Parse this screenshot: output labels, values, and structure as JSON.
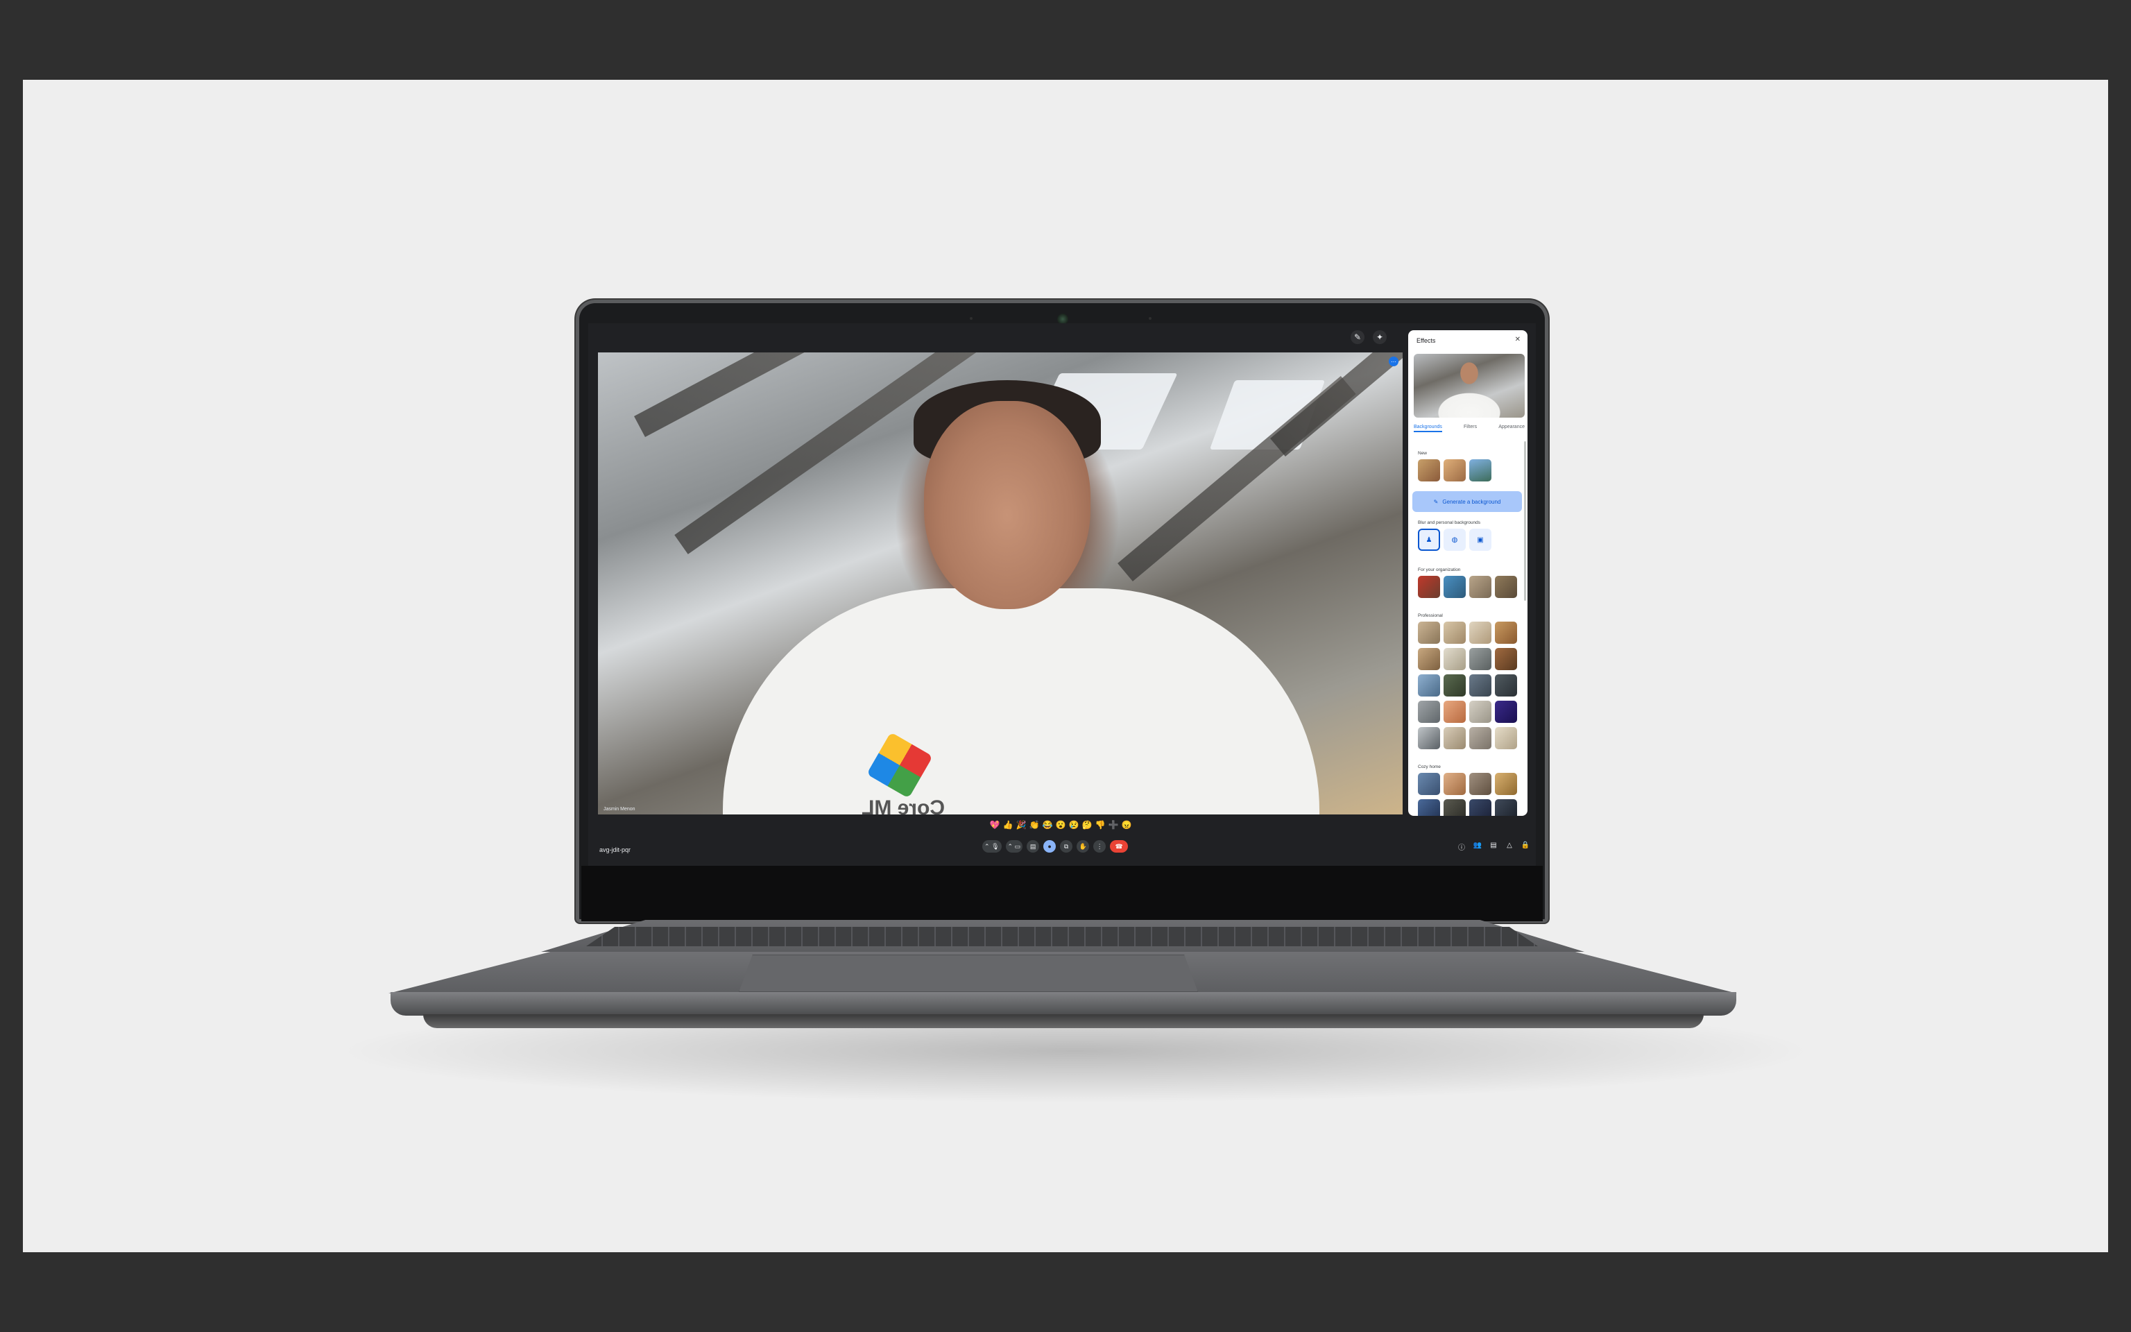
{
  "meeting": {
    "code": "avg-jdit-pqr",
    "participant_name": "Jasmin Menon"
  },
  "reactions": [
    "💖",
    "👍",
    "🎉",
    "👏",
    "😂",
    "😮",
    "😢",
    "🤔",
    "👎",
    "➕",
    "😠"
  ],
  "controls": {
    "more_label": "⌃",
    "mic_icon": "mic-icon",
    "camera_icon": "camera-icon",
    "captions_icon": "captions-icon",
    "effects_icon": "effects-icon",
    "present_icon": "present-icon",
    "raise_hand_icon": "raise-hand-icon",
    "more_options_icon": "more-options-icon",
    "end_call_icon": "end-call-icon",
    "end_call_color": "#ea4335"
  },
  "right_controls": [
    "info-icon",
    "people-icon",
    "chat-icon",
    "activities-icon",
    "host-controls-icon"
  ],
  "effects_panel": {
    "title": "Effects",
    "tabs": [
      "Backgrounds",
      "Filters",
      "Appearance"
    ],
    "selected_tab": "Backgrounds",
    "sections": {
      "new": "New",
      "generate_button": "Generate a background",
      "blur": "Blur and personal backgrounds",
      "organization": "For your organization",
      "professional": "Professional",
      "cozy": "Cozy home"
    },
    "accent_color": "#0b57d0"
  }
}
